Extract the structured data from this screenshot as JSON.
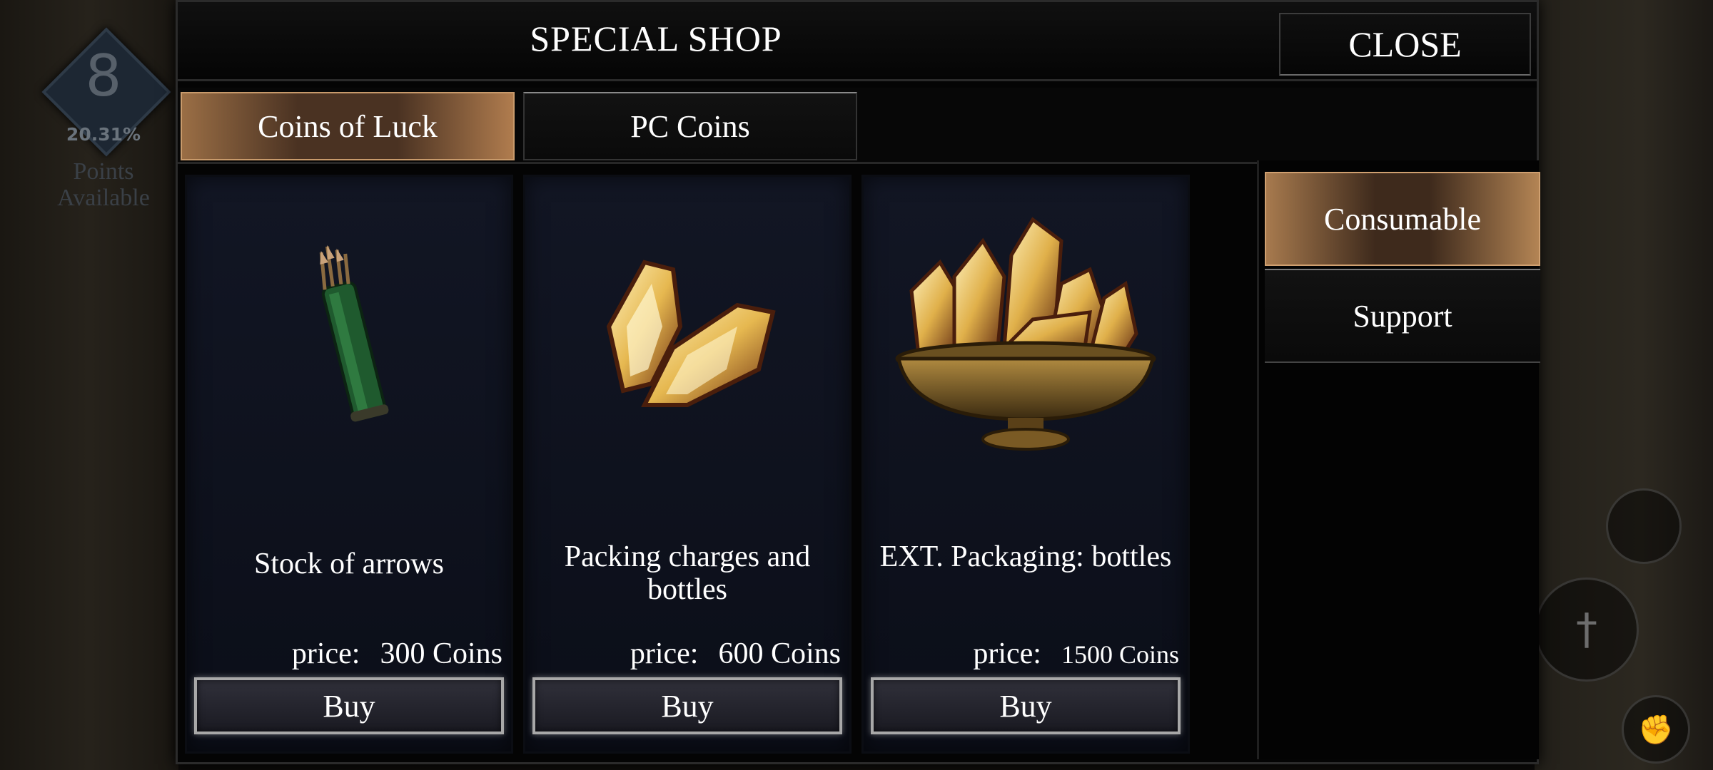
{
  "hud": {
    "level": "8",
    "progress_pct": "20.31%",
    "points_label_line1": "Points",
    "points_label_line2": "Available"
  },
  "shop": {
    "title": "SPECIAL SHOP",
    "close_label": "CLOSE",
    "tabs": [
      {
        "label": "Coins of Luck",
        "active": true
      },
      {
        "label": "PC Coins",
        "active": false
      }
    ],
    "categories": [
      {
        "label": "Consumable",
        "active": true
      },
      {
        "label": "Support",
        "active": false
      }
    ],
    "items": [
      {
        "name": "Stock of arrows",
        "price_label": "price:",
        "price_value": "300 Coins",
        "buy_label": "Buy",
        "icon": "quiver-icon"
      },
      {
        "name": "Packing charges and bottles",
        "price_label": "price:",
        "price_value": "600 Coins",
        "buy_label": "Buy",
        "icon": "crystals-icon"
      },
      {
        "name": "EXT. Packaging: bottles",
        "price_label": "price:",
        "price_value": "1500 Coins",
        "buy_label": "Buy",
        "icon": "crystal-bowl-icon"
      }
    ]
  },
  "colors": {
    "active_tab": "#9a6e45",
    "card_bg": "#121624",
    "panel_bg": "#040404"
  }
}
